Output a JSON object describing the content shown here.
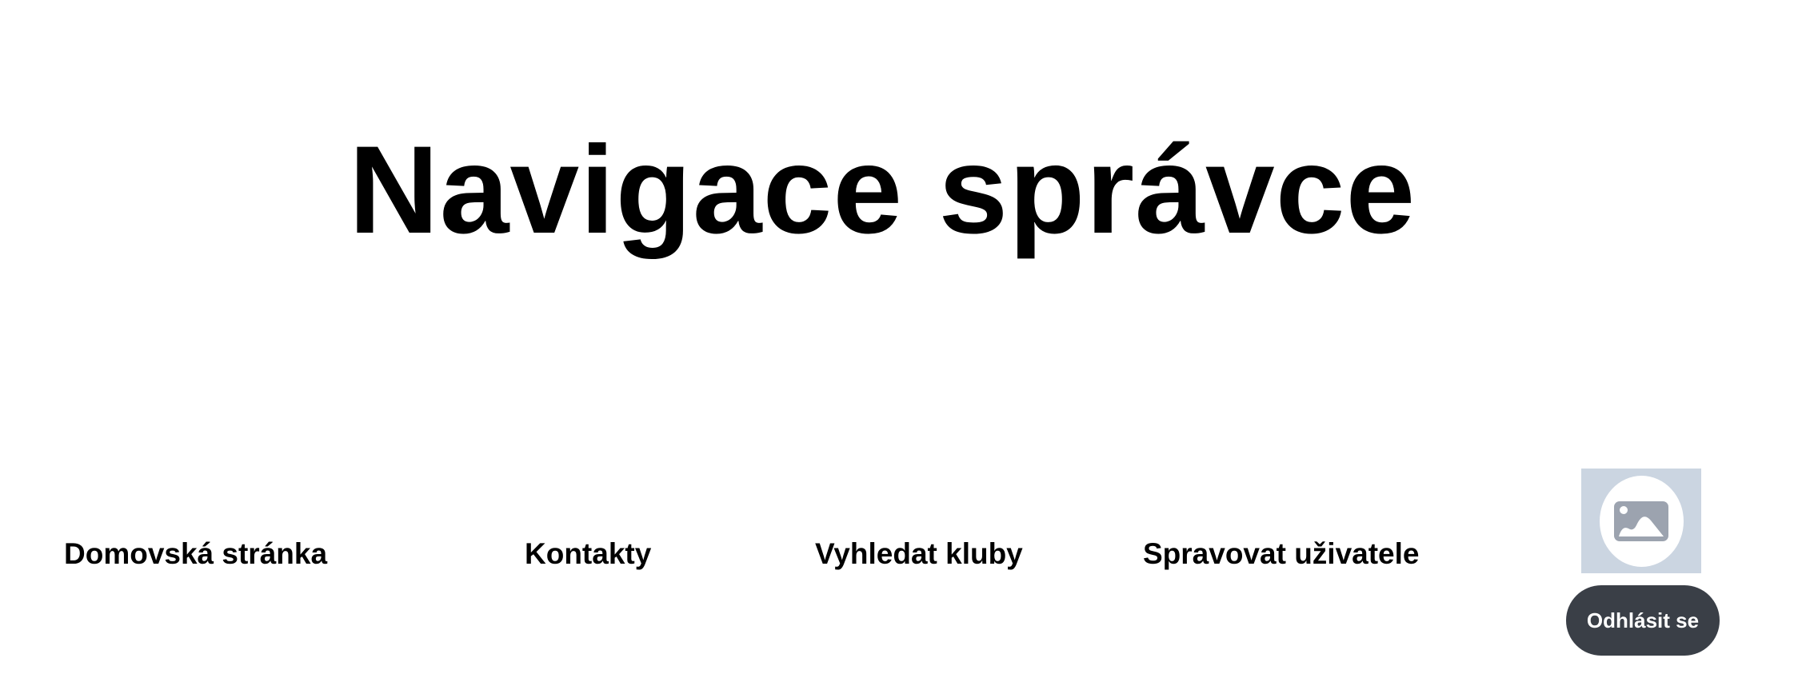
{
  "header": {
    "title": "Navigace správce"
  },
  "nav": {
    "items": [
      {
        "label": "Domovská stránka"
      },
      {
        "label": "Kontakty"
      },
      {
        "label": "Vyhledat kluby"
      },
      {
        "label": "Spravovat uživatele"
      }
    ]
  },
  "user": {
    "avatar_icon": "image-placeholder-icon",
    "logout_label": "Odhlásit se"
  },
  "colors": {
    "avatar_background": "#cbd5e1",
    "icon_fill": "#9ca3af",
    "button_background": "#3a3f47",
    "button_text": "#ffffff"
  }
}
